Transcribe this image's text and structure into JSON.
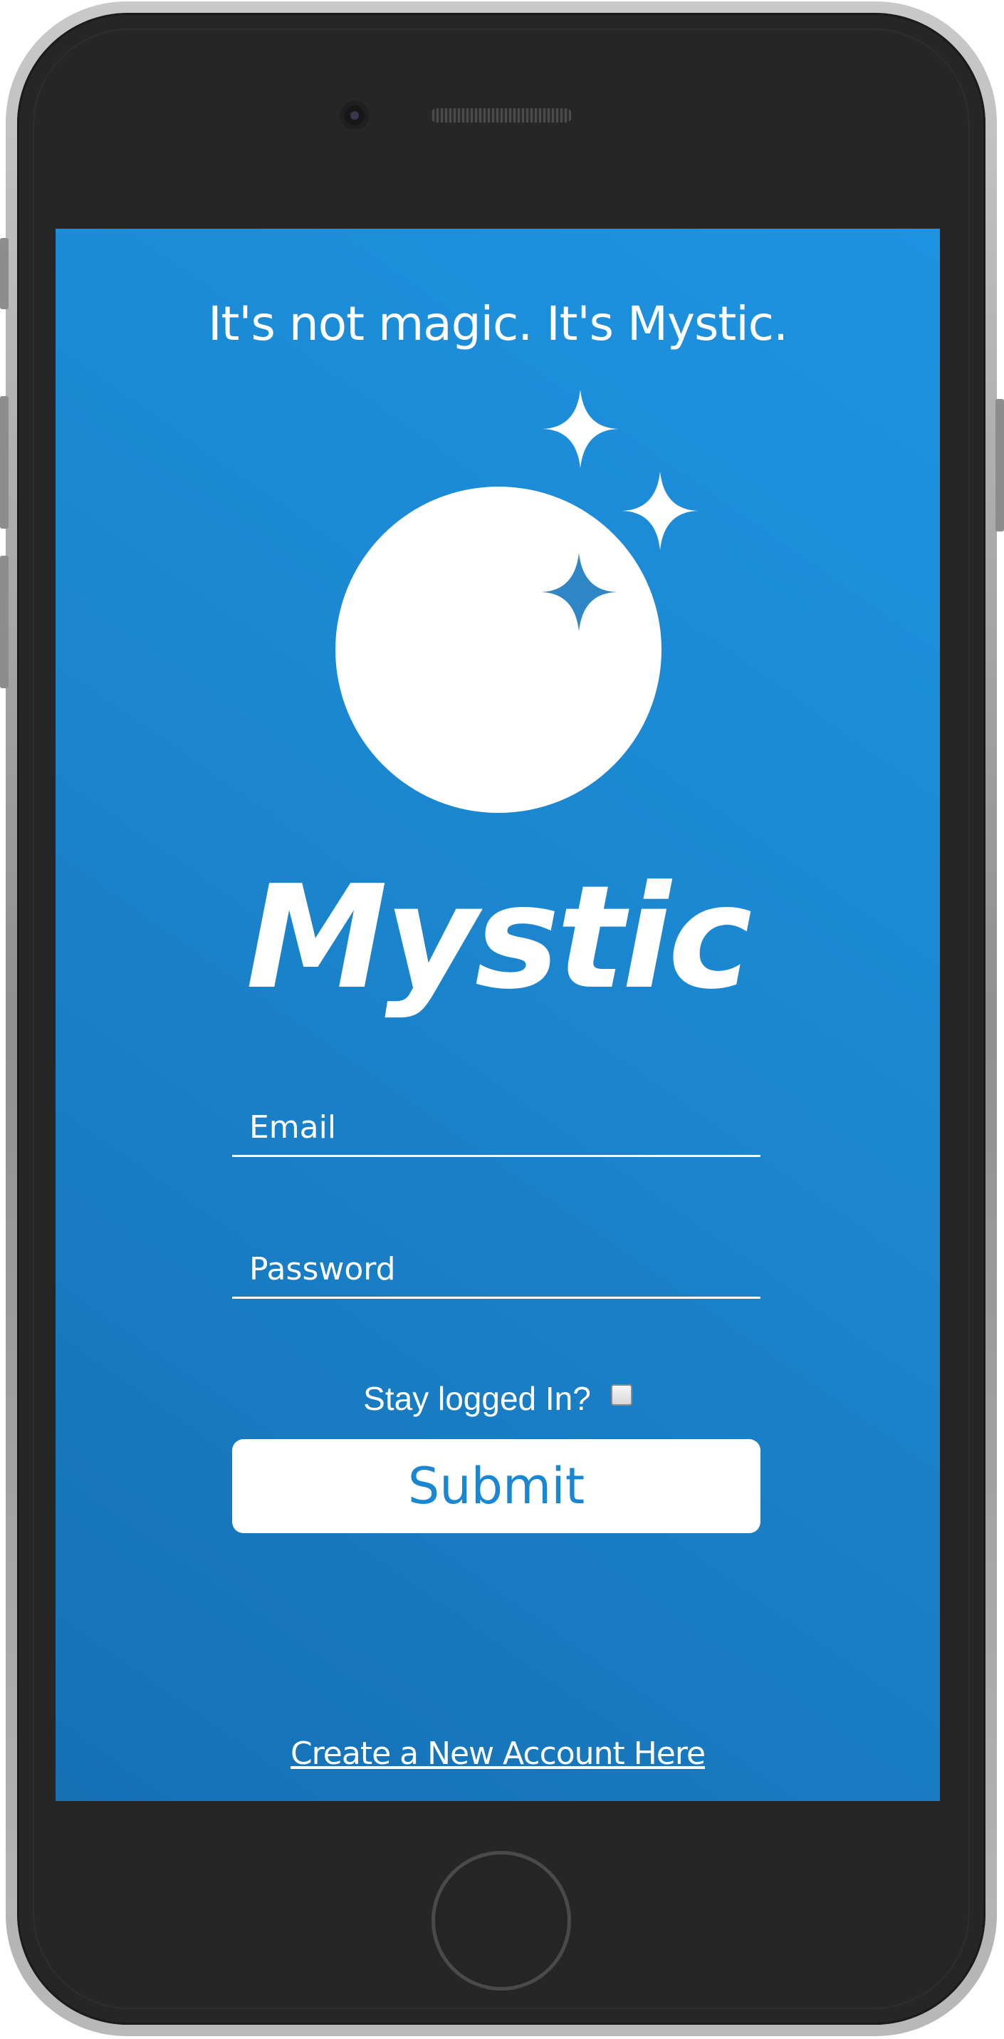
{
  "screen": {
    "tagline": "It's not magic. It's Mystic.",
    "brand_name": "Mystic",
    "logo_icon": "moon-with-sparkles-icon"
  },
  "form": {
    "email_placeholder": "Email",
    "password_placeholder": "Password",
    "stay_logged_label": "Stay logged In?",
    "stay_logged_checked": false,
    "submit_label": "Submit"
  },
  "footer": {
    "create_account_link": "Create a New Account Here"
  },
  "colors": {
    "screen_gradient_dark": "#1570b4",
    "screen_gradient_light": "#1e93e2",
    "inner_sparkle": "#2f86c4",
    "submit_text": "#1b86d2",
    "phone_body": "#262626"
  }
}
